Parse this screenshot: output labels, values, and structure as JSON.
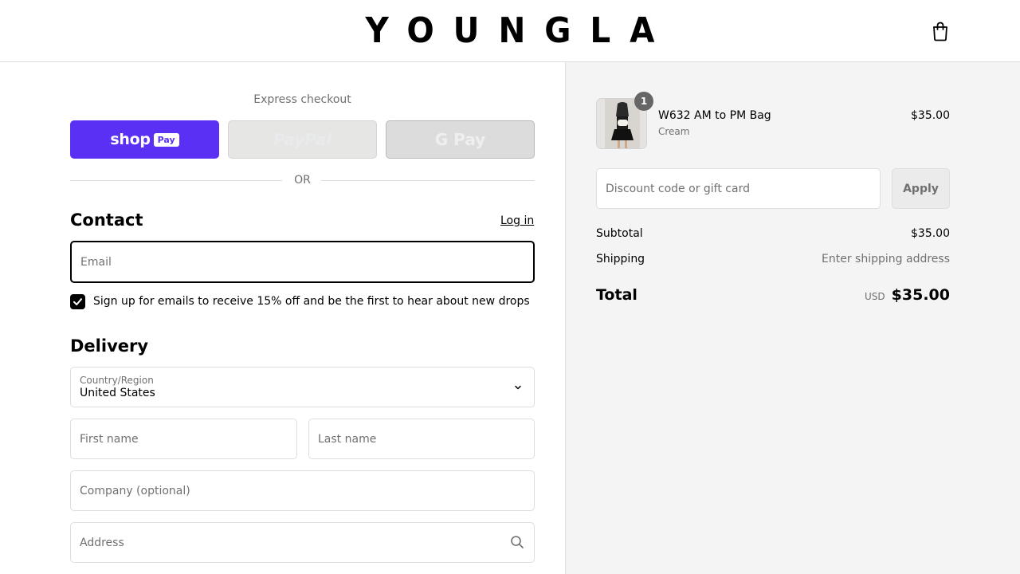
{
  "brand": {
    "logo_text": "YOUNGLA"
  },
  "header": {
    "cart_icon": "shopping-bag-icon"
  },
  "express": {
    "label": "Express checkout",
    "shop_pay": {
      "word": "shop",
      "chip": "Pay"
    },
    "paypal": {
      "text": "PayPal"
    },
    "gpay": {
      "text": "G Pay"
    },
    "divider": "OR"
  },
  "contact": {
    "title": "Contact",
    "login_link": "Log in",
    "email_placeholder": "Email",
    "newsletter_checked": true,
    "newsletter_label": "Sign up for emails to receive 15% off and be the first to hear about new drops"
  },
  "delivery": {
    "title": "Delivery",
    "country_label": "Country/Region",
    "country_value": "United States",
    "first_name_placeholder": "First name",
    "last_name_placeholder": "Last name",
    "company_placeholder": "Company (optional)",
    "address_placeholder": "Address"
  },
  "summary": {
    "item": {
      "quantity": "1",
      "name": "W632 AM to PM Bag",
      "variant": "Cream",
      "price": "$35.00"
    },
    "discount_placeholder": "Discount code or gift card",
    "apply_label": "Apply",
    "subtotal_label": "Subtotal",
    "subtotal_value": "$35.00",
    "shipping_label": "Shipping",
    "shipping_value": "Enter shipping address",
    "total_label": "Total",
    "currency": "USD",
    "total_value": "$35.00"
  },
  "colors": {
    "shop_pay": "#5a31f4",
    "summary_bg": "#f4f4f4"
  }
}
